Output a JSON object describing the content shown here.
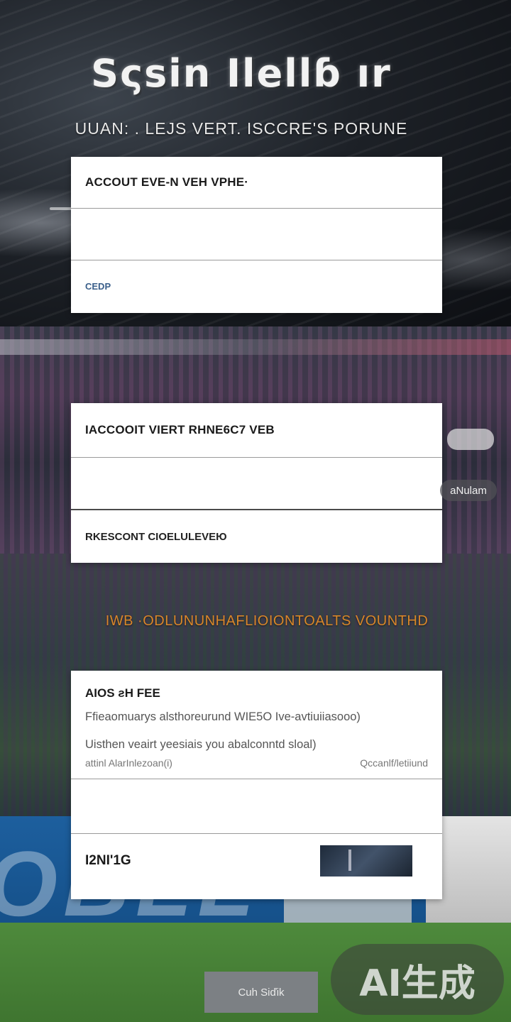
{
  "header": {
    "title": "Sςsin Ilellɓ ır",
    "subtitle": "UUAN: . LEJS VERT. ISCCRE'S  PORUNE"
  },
  "card1": {
    "heading": "ACCOUT EVE-N VEH  VPHE·",
    "field1_value": "",
    "field2_value": "",
    "link": "CEDP"
  },
  "card2": {
    "heading": "IACCOOIT VIERT RHNE6C7  VEB",
    "field_value": "",
    "footer": "RKESCONT CIOELULEVEЮ"
  },
  "side_chip": {
    "label": "aNulam"
  },
  "promo": {
    "text": "IWB  ·ODLUNUNHAFLIOIONTOALTS  VOUNTHD"
  },
  "card3": {
    "title": "AIOS ƨH FEE",
    "line1": "Ffieaomuarys alsthoreurund WIE5O Ive-avtiuiiasooo)",
    "line2": "Uisthen veairt yeesiais you abalconntd sloal)",
    "small_left": "attinl AlarInlezoan(i)",
    "small_right": "Qccanlf/letiiund",
    "field_value": "",
    "footer_label": "I2NI'1G"
  },
  "submit": {
    "label": "Cuh Siďik"
  },
  "watermark": {
    "text": "AI生成"
  }
}
